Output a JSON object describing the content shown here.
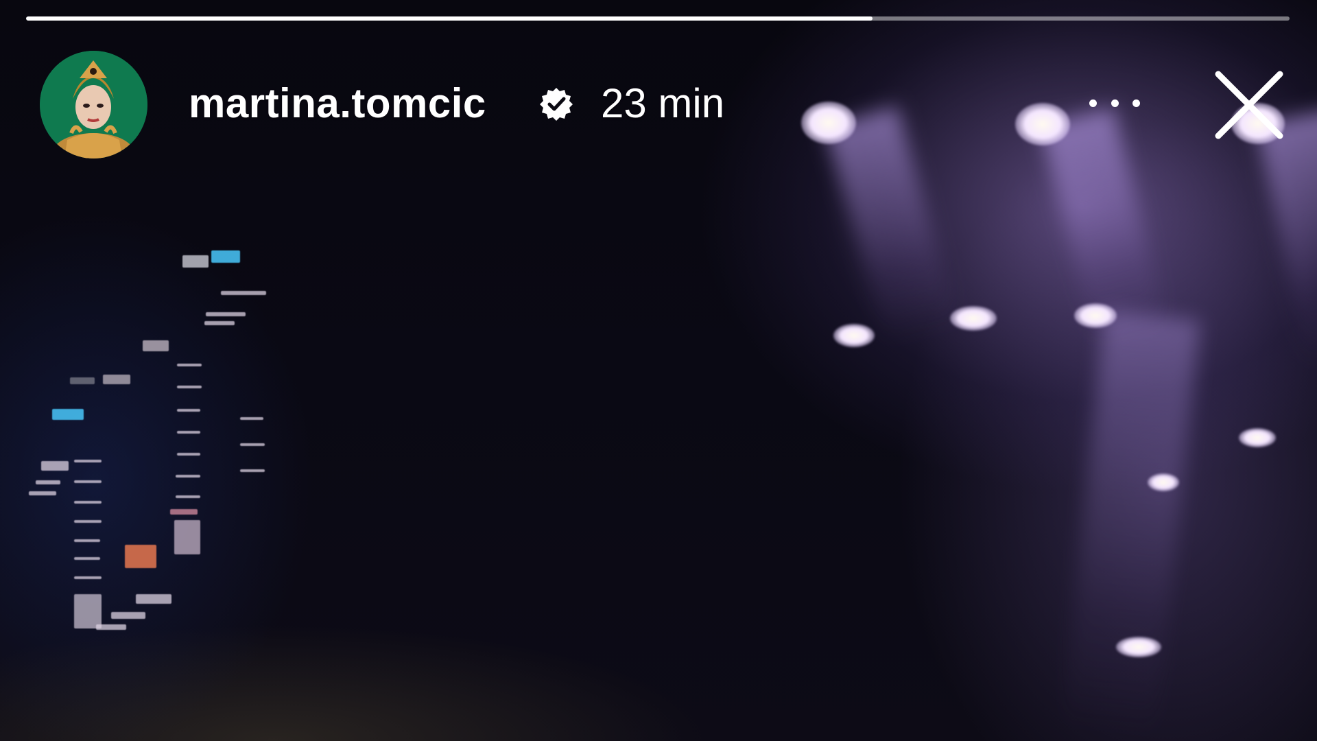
{
  "story": {
    "progress_fraction": 0.67,
    "username": "martina.tomcic",
    "verified": true,
    "timestamp": "23 min"
  },
  "icons": {
    "verified": "verified-badge-icon",
    "more": "more-horizontal-icon",
    "close": "close-icon"
  },
  "colors": {
    "progress_fill": "#ffffff",
    "progress_track": "#b3b3b3",
    "avatar_background": "#0f7a4f"
  }
}
